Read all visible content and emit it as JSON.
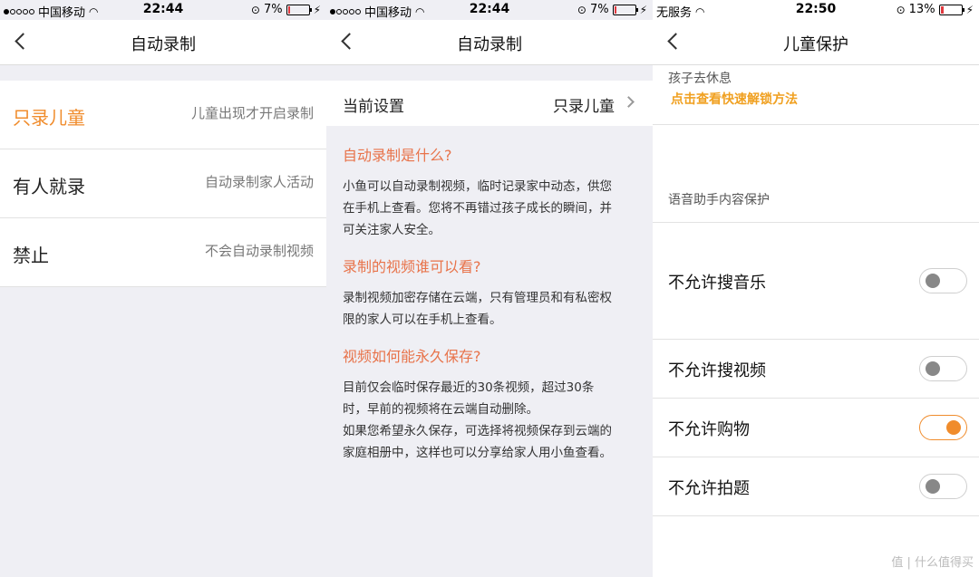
{
  "panel1": {
    "status": {
      "carrier": "中国移动",
      "time": "22:44",
      "battery": "7%",
      "battery_fraction": 0.07
    },
    "title": "自动录制",
    "options": [
      {
        "name": "只录儿童",
        "desc": "儿童出现才开启录制",
        "selected": true
      },
      {
        "name": "有人就录",
        "desc": "自动录制家人活动",
        "selected": false
      },
      {
        "name": "禁止",
        "desc": "不会自动录制视频",
        "selected": false
      }
    ]
  },
  "panel2": {
    "status": {
      "carrier": "中国移动",
      "time": "22:44",
      "battery": "7%",
      "battery_fraction": 0.07
    },
    "title": "自动录制",
    "current_label": "当前设置",
    "current_value": "只录儿童",
    "faq": [
      {
        "q": "自动录制是什么?",
        "a": [
          "小鱼可以自动录制视频，临时记录家中动态，供您",
          "在手机上查看。您将不再错过孩子成长的瞬间，并",
          "可关注家人安全。"
        ]
      },
      {
        "q": "录制的视频谁可以看?",
        "a": [
          "录制视频加密存储在云端，只有管理员和有私密权",
          "限的家人可以在手机上查看。"
        ]
      },
      {
        "q": "视频如何能永久保存?",
        "a": [
          "目前仅会临时保存最近的30条视频，超过30条",
          "时，早前的视频将在云端自动删除。",
          "如果您希望永久保存，可选择将视频保存到云端的",
          "家庭相册中，这样也可以分享给家人用小鱼查看。"
        ]
      }
    ]
  },
  "panel3": {
    "status": {
      "carrier": "无服务",
      "time": "22:50",
      "battery": "13%",
      "battery_fraction": 0.13
    },
    "title": "儿童保护",
    "rest_text": "孩子去休息",
    "unlock_link": "点击查看快速解锁方法",
    "section_header": "语音助手内容保护",
    "toggles": [
      {
        "label": "不允许搜音乐",
        "on": false
      },
      {
        "label": "不允许搜视频",
        "on": false
      },
      {
        "label": "不允许购物",
        "on": true
      },
      {
        "label": "不允许拍题",
        "on": false
      }
    ]
  },
  "watermark": "值 | 什么值得买",
  "colors": {
    "accent": "#f08c2c",
    "faq_question": "#e8734a",
    "link": "#f0a020",
    "battery_low": "#e0383e"
  }
}
